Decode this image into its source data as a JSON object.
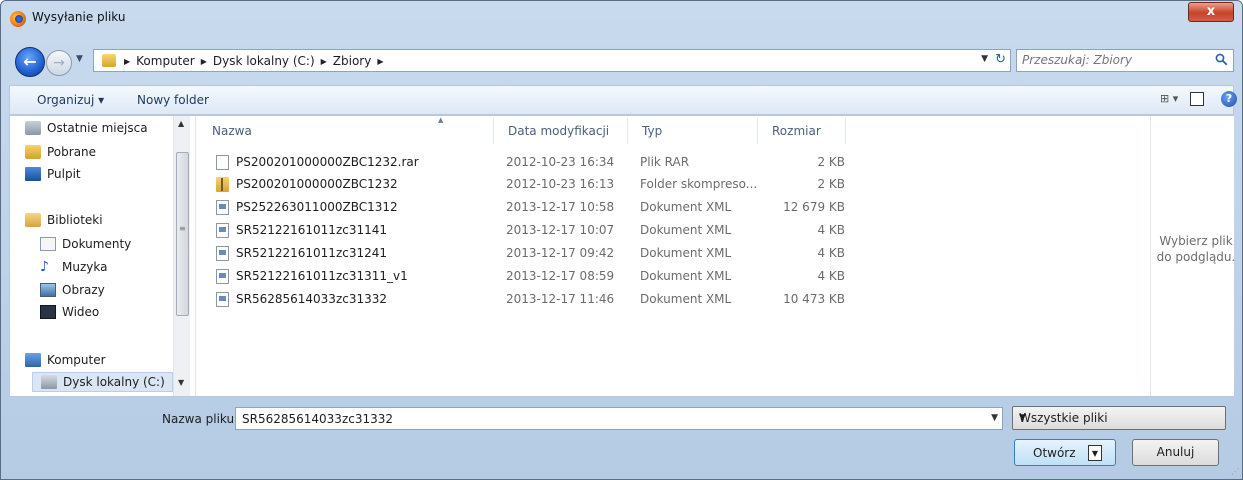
{
  "window": {
    "title": "Wysyłanie pliku",
    "close_glyph": "x"
  },
  "nav": {
    "breadcrumbs": [
      "Komputer",
      "Dysk lokalny (C:)",
      "Zbiory"
    ],
    "search_placeholder": "Przeszukaj: Zbiory"
  },
  "toolbar": {
    "organize_label": "Organizuj ▾",
    "new_folder_label": "Nowy folder",
    "views_glyph": "⊞ ▾",
    "help_glyph": "?"
  },
  "sidebar": {
    "items": [
      {
        "label": "Ostatnie miejsca",
        "icon": "recent-places-icon"
      },
      {
        "label": "Pobrane",
        "icon": "downloads-icon"
      },
      {
        "label": "Pulpit",
        "icon": "desktop-icon"
      },
      {
        "label": "Biblioteki",
        "icon": "libraries-icon"
      },
      {
        "label": "Dokumenty",
        "icon": "documents-icon"
      },
      {
        "label": "Muzyka",
        "icon": "music-icon"
      },
      {
        "label": "Obrazy",
        "icon": "pictures-icon"
      },
      {
        "label": "Wideo",
        "icon": "video-icon"
      },
      {
        "label": "Komputer",
        "icon": "computer-icon"
      },
      {
        "label": "Dysk lokalny (C:)",
        "icon": "drive-icon"
      }
    ]
  },
  "files": {
    "columns": [
      "Nazwa",
      "Data modyfikacji",
      "Typ",
      "Rozmiar"
    ],
    "rows": [
      {
        "name": "PS200201000000ZBC1232.rar",
        "date": "2012-10-23 16:34",
        "type": "Plik RAR",
        "size": "2 KB",
        "icon": "rar-file-icon"
      },
      {
        "name": "PS200201000000ZBC1232",
        "date": "2012-10-23 16:13",
        "type": "Folder skompreso...",
        "size": "2 KB",
        "icon": "zip-folder-icon"
      },
      {
        "name": "PS252263011000ZBC1312",
        "date": "2013-12-17 10:58",
        "type": "Dokument XML",
        "size": "12 679 KB",
        "icon": "xml-file-icon"
      },
      {
        "name": "SR52122161011zc31141",
        "date": "2013-12-17 10:07",
        "type": "Dokument XML",
        "size": "4 KB",
        "icon": "xml-file-icon"
      },
      {
        "name": "SR52122161011zc31241",
        "date": "2013-12-17 09:42",
        "type": "Dokument XML",
        "size": "4 KB",
        "icon": "xml-file-icon"
      },
      {
        "name": "SR52122161011zc31311_v1",
        "date": "2013-12-17 08:59",
        "type": "Dokument XML",
        "size": "4 KB",
        "icon": "xml-file-icon"
      },
      {
        "name": "SR56285614033zc31332",
        "date": "2013-12-17 11:46",
        "type": "Dokument XML",
        "size": "10 473 KB",
        "icon": "xml-file-icon"
      }
    ]
  },
  "preview": {
    "message": "Wybierz plik do podglądu."
  },
  "footer": {
    "filename_label": "Nazwa pliku:",
    "filename_value": "SR56285614033zc31332",
    "filetype_value": "Wszystkie pliki",
    "open_label": "Otwórz",
    "cancel_label": "Anuluj"
  },
  "colors": {
    "accent": "#3c7fb1",
    "title_close": "#c7432a"
  }
}
